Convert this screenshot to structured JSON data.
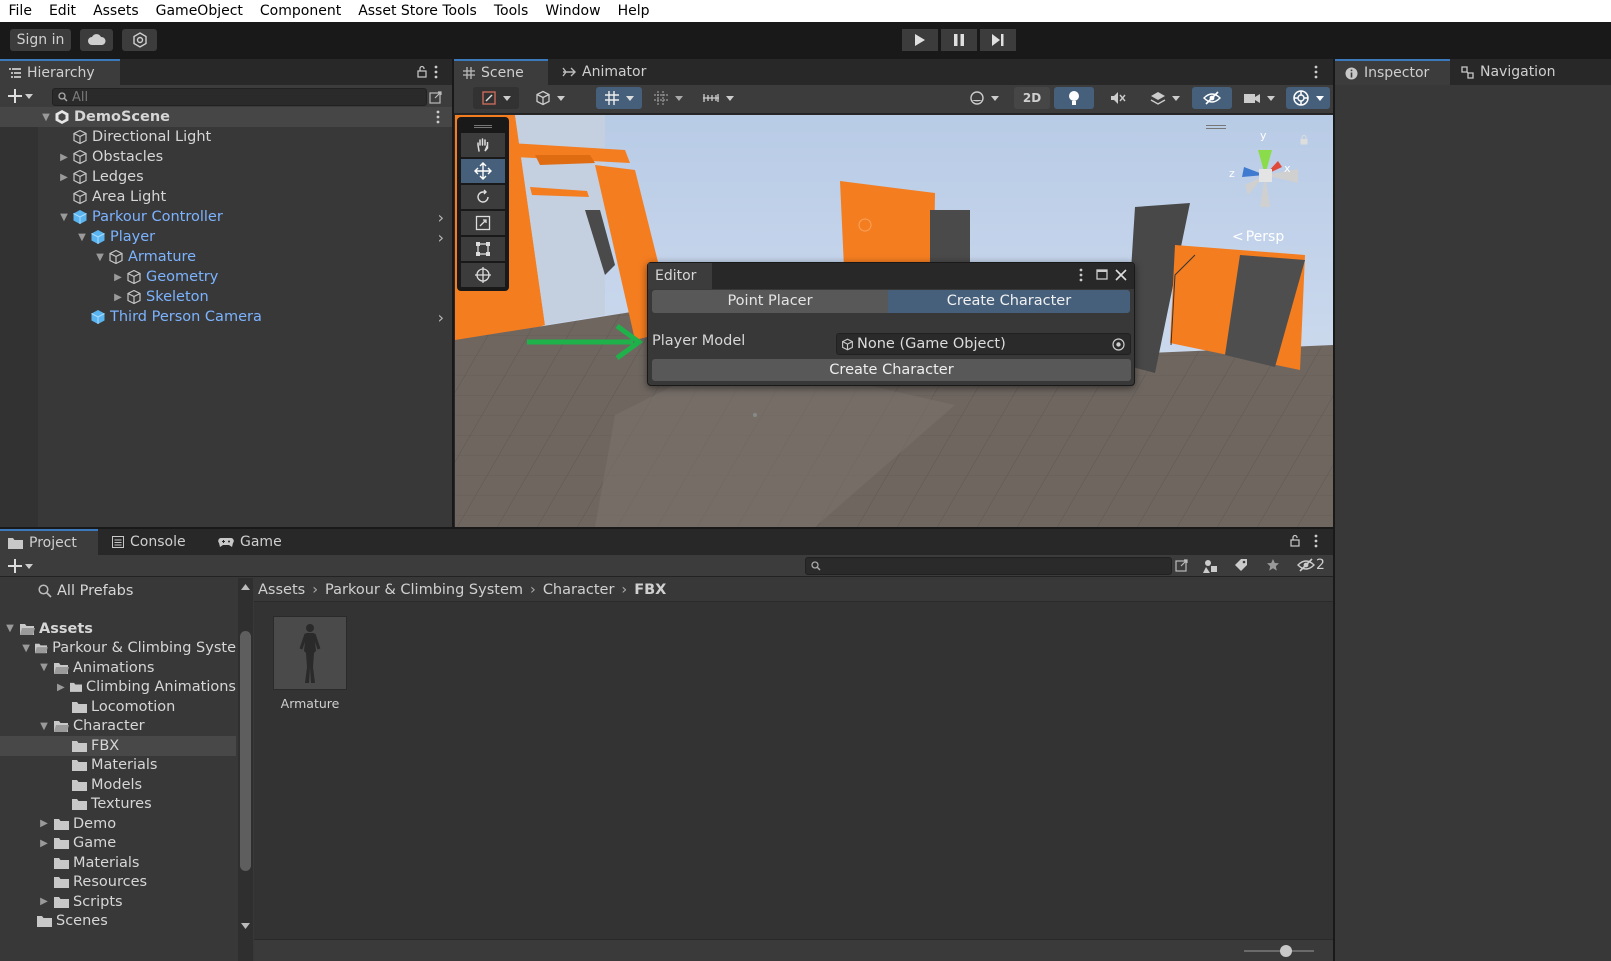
{
  "menu": [
    "File",
    "Edit",
    "Assets",
    "GameObject",
    "Component",
    "Asset Store Tools",
    "Tools",
    "Window",
    "Help"
  ],
  "toolbar": {
    "sign_in": "Sign in"
  },
  "hierarchy": {
    "tab": "Hierarchy",
    "search_placeholder": "All",
    "scene": "DemoScene",
    "items": [
      {
        "label": "Directional Light"
      },
      {
        "label": "Obstacles"
      },
      {
        "label": "Ledges"
      },
      {
        "label": "Area Light"
      },
      {
        "label": "Parkour Controller"
      },
      {
        "label": "Player"
      },
      {
        "label": "Armature"
      },
      {
        "label": "Geometry"
      },
      {
        "label": "Skeleton"
      },
      {
        "label": "Third Person Camera"
      }
    ]
  },
  "scene_tabs": {
    "scene": "Scene",
    "animator": "Animator"
  },
  "scene_toolbar": {
    "mode_2d": "2D"
  },
  "gizmo": {
    "persp": "Persp",
    "x": "x",
    "y": "y",
    "z": "z"
  },
  "editor_window": {
    "title": "Editor",
    "tabs": [
      "Point Placer",
      "Create Character"
    ],
    "active_tab": "Create Character",
    "player_model_label": "Player Model",
    "player_model_value": "None (Game Object)",
    "create_button": "Create Character"
  },
  "right_tabs": {
    "inspector": "Inspector",
    "navigation": "Navigation"
  },
  "bottom_tabs": {
    "project": "Project",
    "console": "Console",
    "game": "Game"
  },
  "project": {
    "all_prefabs": "All Prefabs",
    "hidden_count": "2",
    "tree": [
      {
        "label": "Assets"
      },
      {
        "label": "Parkour & Climbing Syste"
      },
      {
        "label": "Animations"
      },
      {
        "label": "Climbing Animations"
      },
      {
        "label": "Locomotion"
      },
      {
        "label": "Character"
      },
      {
        "label": "FBX"
      },
      {
        "label": "Materials"
      },
      {
        "label": "Models"
      },
      {
        "label": "Textures"
      },
      {
        "label": "Demo"
      },
      {
        "label": "Game"
      },
      {
        "label": "Materials"
      },
      {
        "label": "Resources"
      },
      {
        "label": "Scripts"
      },
      {
        "label": "Scenes"
      }
    ],
    "breadcrumb": [
      "Assets",
      "Parkour & Climbing System",
      "Character",
      "FBX"
    ],
    "assets": [
      {
        "label": "Armature"
      }
    ]
  },
  "colors": {
    "accent": "#3a79bb",
    "orange": "#f47d20",
    "green_arrow": "#1fb24a",
    "prefab_blue": "#7cb3ff"
  }
}
